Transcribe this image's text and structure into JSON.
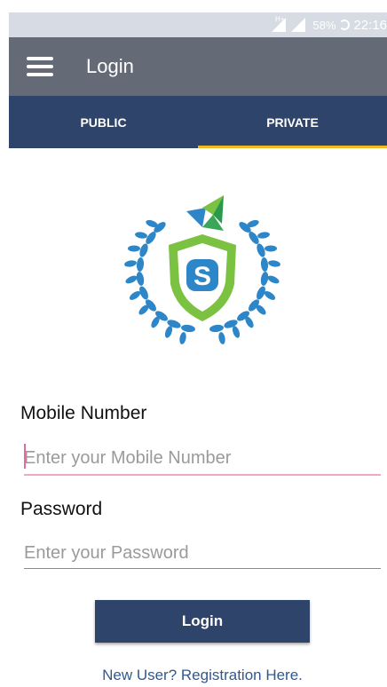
{
  "status_bar": {
    "network": "H+",
    "battery": "58%",
    "time": "22:16"
  },
  "app_bar": {
    "title": "Login",
    "menu_icon": "hamburger-menu-icon"
  },
  "tabs": [
    {
      "label": "PUBLIC",
      "active": false
    },
    {
      "label": "PRIVATE",
      "active": true
    }
  ],
  "form": {
    "mobile_label": "Mobile Number",
    "mobile_placeholder": "Enter your Mobile Number",
    "password_label": "Password",
    "password_placeholder": "Enter your Password",
    "login_button": "Login",
    "register_link": "New User? Registration Here."
  },
  "colors": {
    "status_bar": "#d7dbe3",
    "app_bar": "#646b76",
    "primary": "#2f446a",
    "tab_indicator": "#f2b81d",
    "focus_underline": "#f3a6c6",
    "link": "#2f5a8f",
    "logo_blue": "#2d86c8",
    "logo_green": "#7cc242"
  }
}
